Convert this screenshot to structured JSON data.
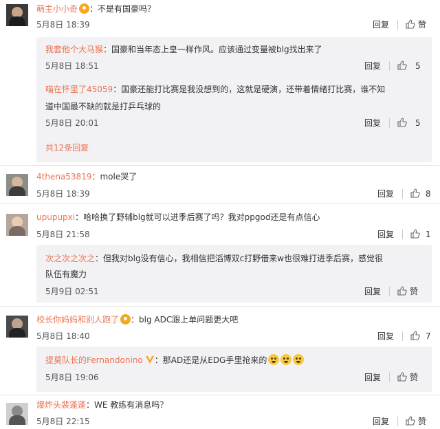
{
  "actions": {
    "reply": "回复",
    "like": "赞"
  },
  "comments": [
    {
      "username": "萌主小小奇",
      "text": "：不是有国豪吗？",
      "time": "5月8日 18:39",
      "likes": "",
      "replies": [
        {
          "username": "我套他个大马猴",
          "text": "：国豪和当年态上皇一样作风。应该通过变量被blg找出来了",
          "time": "5月8日 18:51",
          "likes": "5"
        },
        {
          "username": "喵在怀里了45059",
          "text": "：国豪还能打比赛是我没想到的，这就是硬演，还带着情绪打比赛，谁不知",
          "text2": "道中国最不缺的就是打乒乓球的",
          "time": "5月8日 20:01",
          "likes": "5"
        }
      ],
      "more": "共12条回复"
    },
    {
      "username": "4thena53819",
      "text": "：mole哭了",
      "time": "5月8日 18:39",
      "likes": "8",
      "replies": []
    },
    {
      "username": "upupupxi",
      "text": "：哈哈换了野辅blg就可以进季后赛了吗？我对ppgod还是有点信心",
      "time": "5月8日 21:58",
      "likes": "1",
      "replies": [
        {
          "username": "次之次之次之",
          "text": "：但我对blg没有信心，我相信把滔博双c打野借来w也很难打进季后赛，感觉很",
          "text2": "队伍有魔力",
          "time": "5月9日 02:51",
          "likes": ""
        }
      ]
    },
    {
      "username": "校长你妈妈和别人跑了",
      "text": "：blg ADC跟上单问题更大吧",
      "time": "5月8日 18:40",
      "likes": "7",
      "replies": [
        {
          "username": "提莫队长的Fernandonino",
          "text": "：那AD还是从EDG手里抢来的",
          "time": "5月8日 19:06",
          "likes": ""
        }
      ]
    },
    {
      "username": "爆炸头裴蓬蓬",
      "text": "：WE 教练有消息吗？",
      "time": "5月8日 22:15",
      "likes": "",
      "replies": []
    }
  ]
}
